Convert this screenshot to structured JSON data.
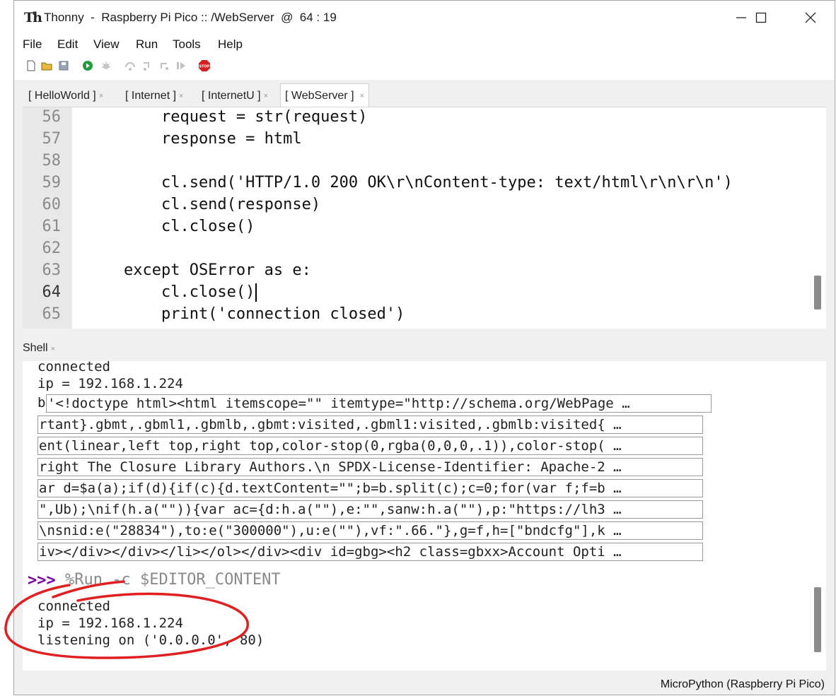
{
  "window": {
    "icon_text": "Th",
    "title": "Thonny  -  Raspberry Pi Pico :: /WebServer  @  64 : 19"
  },
  "menu": [
    "File",
    "Edit",
    "View",
    "Run",
    "Tools",
    "Help"
  ],
  "toolbar_icons": [
    "new-file-icon",
    "open-file-icon",
    "save-icon",
    "run-icon",
    "debug-icon",
    "step-over-icon",
    "step-into-icon",
    "step-out-icon",
    "resume-icon",
    "stop-icon"
  ],
  "stop_label": "STOP",
  "tabs": [
    {
      "label": "[ HelloWorld ]",
      "close": "×"
    },
    {
      "label": "[ Internet ]",
      "close": "×"
    },
    {
      "label": "[ InternetU ]",
      "close": "×"
    },
    {
      "label": "[ WebServer ]",
      "close": "×"
    }
  ],
  "editor": {
    "current_line": "64",
    "lines": [
      {
        "n": "56",
        "code": "        request = str(request)"
      },
      {
        "n": "57",
        "code": "        response = html"
      },
      {
        "n": "58",
        "code": ""
      },
      {
        "n": "59",
        "code": "        cl.send('HTTP/1.0 200 OK\\r\\nContent-type: text/html\\r\\n\\r\\n')"
      },
      {
        "n": "60",
        "code": "        cl.send(response)"
      },
      {
        "n": "61",
        "code": "        cl.close()"
      },
      {
        "n": "62",
        "code": ""
      },
      {
        "n": "63",
        "code": "    except OSError as e:"
      },
      {
        "n": "64",
        "code": "        cl.close()"
      },
      {
        "n": "65",
        "code": "        print('connection closed')"
      }
    ]
  },
  "shell": {
    "tab_label": "Shell",
    "tab_close": "×",
    "pre_lines": [
      "connected",
      "ip = 192.168.1.224"
    ],
    "b_prefix": "b",
    "truncated_lines": [
      "'<!doctype html><html itemscope=\"\" itemtype=\"http://schema.org/WebPage …",
      "rtant}.gbmt,.gbml1,.gbmlb,.gbmt:visited,.gbml1:visited,.gbmlb:visited{ …",
      "ent(linear,left top,right top,color-stop(0,rgba(0,0,0,.1)),color-stop( …",
      "right The Closure Library Authors.\\n SPDX-License-Identifier: Apache-2 …",
      "ar d=$a(a);if(d){if(c){d.textContent=\"\";b=b.split(c);c=0;for(var f;f=b …",
      "\",Ub);\\nif(h.a(\"\")){var ac={d:h.a(\"\"),e:\"\",sanw:h.a(\"\"),p:\"https://lh3 …",
      "\\nsnid:e(\"28834\"),to:e(\"300000\"),u:e(\"\"),vf:\".66.\"},g=f,h=[\"bndcfg\"],k …",
      "iv></div></div></li></ol></div><div id=gbg><h2 class=gbxx>Account Opti …"
    ],
    "prompt": ">>>",
    "run_command": "%Run -c $EDITOR_CONTENT",
    "post_lines": [
      "connected",
      "ip = 192.168.1.224",
      "listening on ('0.0.0.0', 80)"
    ]
  },
  "status": "MicroPython (Raspberry Pi Pico)",
  "colors": {
    "annotation": "#e02020",
    "prompt": "#7a00a0",
    "stop": "#d42020",
    "run": "#1f9d3c"
  }
}
